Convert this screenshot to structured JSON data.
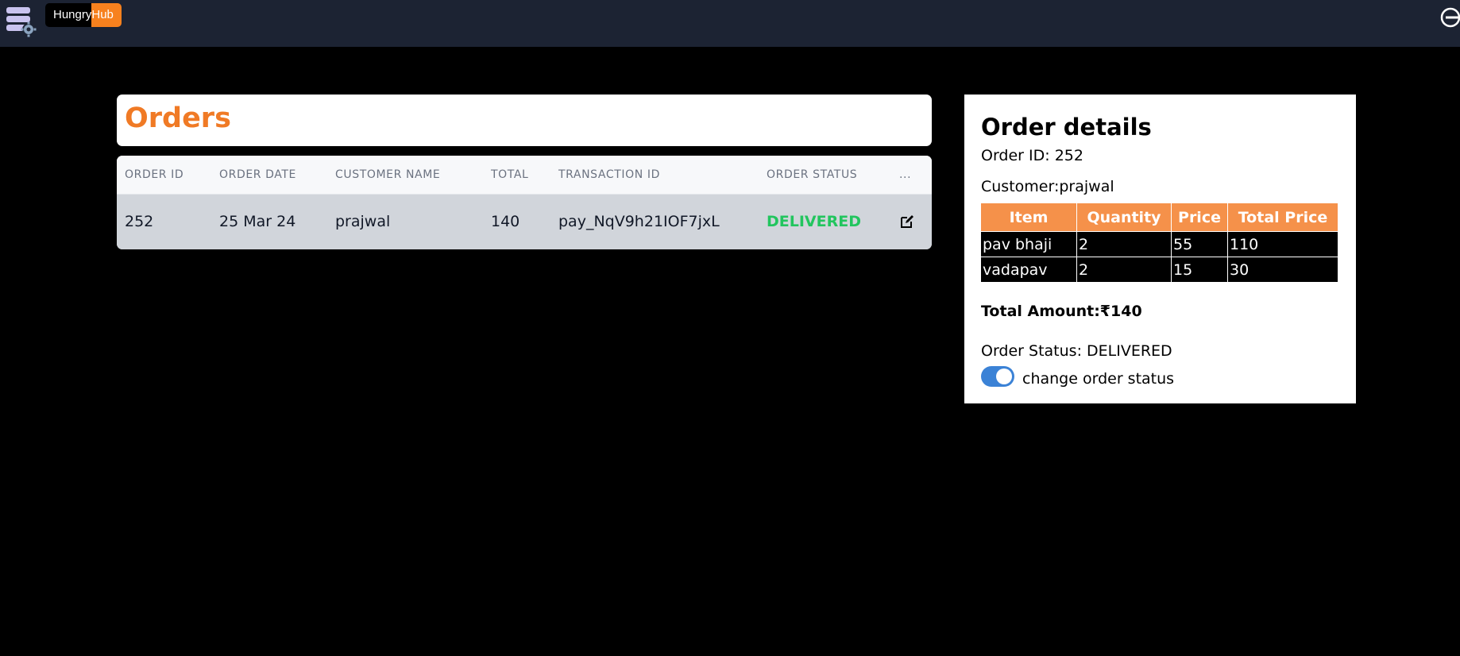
{
  "brand": {
    "part1": "Hungry",
    "part2": "Hub"
  },
  "icons": {
    "admin": "admin-settings-icon",
    "logout": "logout-icon",
    "edit": "edit-icon"
  },
  "colors": {
    "accent": "#f07a25",
    "status_delivered": "#22c55e",
    "table_header": "#f5914a",
    "toggle_on": "#3b82d6"
  },
  "orders": {
    "title": "Orders",
    "columns": [
      "ORDER ID",
      "ORDER DATE",
      "CUSTOMER NAME",
      "TOTAL",
      "TRANSACTION ID",
      "ORDER STATUS",
      "..."
    ],
    "rows": [
      {
        "order_id": "252",
        "order_date": "25 Mar 24",
        "customer_name": "prajwal",
        "total": "140",
        "transaction_id": "pay_NqV9h21IOF7jxL",
        "order_status": "DELIVERED"
      }
    ]
  },
  "details": {
    "title": "Order details",
    "order_id_line": "Order ID: 252",
    "customer_line": "Customer:prajwal",
    "item_columns": [
      "Item",
      "Quantity",
      "Price",
      "Total Price"
    ],
    "items": [
      [
        "pav bhaji",
        "2",
        "55",
        "110"
      ],
      [
        "vadapav",
        "2",
        "15",
        "30"
      ]
    ],
    "total_amount_line": "Total Amount:₹140",
    "status_line": "Order Status: DELIVERED",
    "toggle_label": "change order status",
    "toggle_on": true
  }
}
